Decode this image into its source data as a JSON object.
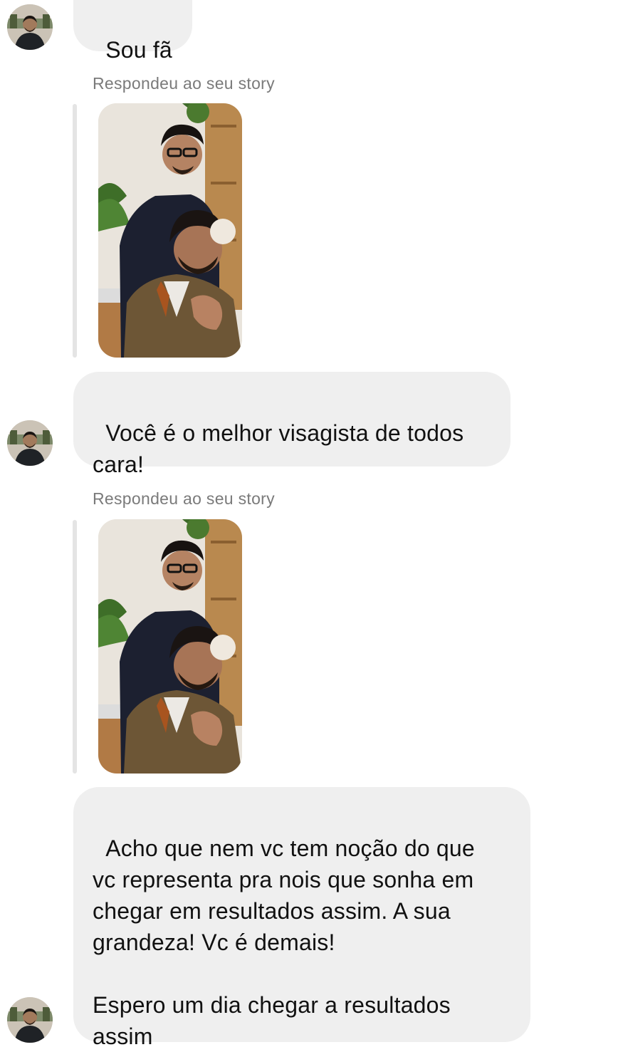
{
  "conversation": {
    "messages": [
      {
        "type": "text",
        "text": "Sou fã"
      },
      {
        "type": "story_reply",
        "caption": "Respondeu ao seu story",
        "thumbnail": "story-photo-two-men-barbershop"
      },
      {
        "type": "text",
        "text": "Você é o melhor visagista de todos\ncara!"
      },
      {
        "type": "story_reply",
        "caption": "Respondeu ao seu story",
        "thumbnail": "story-photo-two-men-barbershop"
      },
      {
        "type": "text",
        "text": "Acho que nem vc tem noção do que\nvc representa pra nois que sonha em\nchegar em resultados assim. A sua\ngrandeza! Vc é demais!\n\nEspero um dia chegar a resultados\nassim"
      }
    ],
    "sender_avatar": "profile-avatar-man-in-shop"
  },
  "colors": {
    "bubble": "#efefef",
    "caption": "#7a7a7a",
    "reply_bar": "#e4e4e4",
    "text": "#111111"
  }
}
